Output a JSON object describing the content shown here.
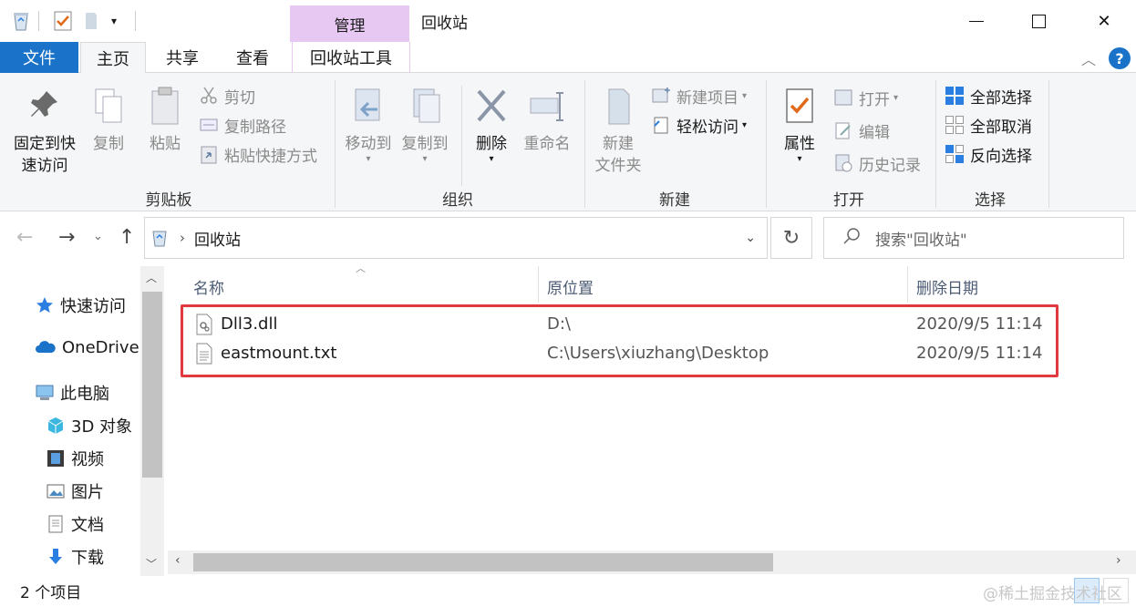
{
  "window": {
    "title": "回收站",
    "context_tab": "管理",
    "controls": {
      "minimize": "—",
      "maximize": "☐",
      "close": "✕"
    }
  },
  "ribbon_tabs": {
    "file": "文件",
    "home": "主页",
    "share": "共享",
    "view": "查看",
    "tools": "回收站工具"
  },
  "ribbon": {
    "clipboard": {
      "label": "剪贴板",
      "pin_line1": "固定到快",
      "pin_line2": "速访问",
      "copy": "复制",
      "paste": "粘贴",
      "cut": "剪切",
      "copy_path": "复制路径",
      "paste_shortcut": "粘贴快捷方式"
    },
    "organize": {
      "label": "组织",
      "move_to": "移动到",
      "copy_to": "复制到",
      "delete": "删除",
      "rename": "重命名"
    },
    "new": {
      "label": "新建",
      "new_folder_line1": "新建",
      "new_folder_line2": "文件夹",
      "new_item": "新建项目",
      "easy_access": "轻松访问"
    },
    "open": {
      "label": "打开",
      "properties": "属性",
      "open": "打开",
      "edit": "编辑",
      "history": "历史记录"
    },
    "select": {
      "label": "选择",
      "select_all": "全部选择",
      "select_none": "全部取消",
      "invert": "反向选择"
    }
  },
  "address": {
    "path": "回收站",
    "search_placeholder": "搜索\"回收站\""
  },
  "nav_pane": {
    "quick_access": "快速访问",
    "onedrive": "OneDrive",
    "this_pc": "此电脑",
    "objects3d": "3D 对象",
    "videos": "视频",
    "pictures": "图片",
    "documents": "文档",
    "downloads": "下载"
  },
  "columns": {
    "name": "名称",
    "location": "原位置",
    "date": "删除日期"
  },
  "files": [
    {
      "name": "Dll3.dll",
      "location": "D:\\",
      "date": "2020/9/5 11:14"
    },
    {
      "name": "eastmount.txt",
      "location": "C:\\Users\\xiuzhang\\Desktop",
      "date": "2020/9/5 11:14"
    }
  ],
  "status": {
    "count": "2 个项目"
  },
  "watermark": "@稀土掘金技术社区",
  "colors": {
    "accent": "#1a73c8",
    "context_tab": "#e6c8f2",
    "highlight_border": "#e0393e"
  }
}
